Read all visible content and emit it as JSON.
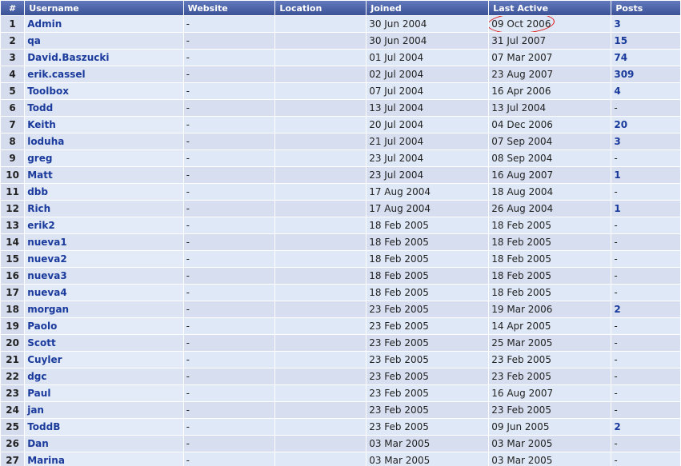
{
  "headers": {
    "num": "#",
    "username": "Username",
    "website": "Website",
    "location": "Location",
    "joined": "Joined",
    "last_active": "Last Active",
    "posts": "Posts"
  },
  "rows": [
    {
      "num": "1",
      "username": "Admin",
      "website": "-",
      "location": "",
      "joined": "30 Jun 2004",
      "last": "09 Oct 2006",
      "posts": "3"
    },
    {
      "num": "2",
      "username": "qa",
      "website": "-",
      "location": "",
      "joined": "30 Jun 2004",
      "last": "31 Jul 2007",
      "posts": "15"
    },
    {
      "num": "3",
      "username": "David.Baszucki",
      "website": "-",
      "location": "",
      "joined": "01 Jul 2004",
      "last": "07 Mar 2007",
      "posts": "74"
    },
    {
      "num": "4",
      "username": "erik.cassel",
      "website": "-",
      "location": "",
      "joined": "02 Jul 2004",
      "last": "23 Aug 2007",
      "posts": "309"
    },
    {
      "num": "5",
      "username": "Toolbox",
      "website": "-",
      "location": "",
      "joined": "07 Jul 2004",
      "last": "16 Apr 2006",
      "posts": "4"
    },
    {
      "num": "6",
      "username": "Todd",
      "website": "-",
      "location": "",
      "joined": "13 Jul 2004",
      "last": "13 Jul 2004",
      "posts": "-"
    },
    {
      "num": "7",
      "username": "Keith",
      "website": "-",
      "location": "",
      "joined": "20 Jul 2004",
      "last": "04 Dec 2006",
      "posts": "20"
    },
    {
      "num": "8",
      "username": "loduha",
      "website": "-",
      "location": "",
      "joined": "21 Jul 2004",
      "last": "07 Sep 2004",
      "posts": "3"
    },
    {
      "num": "9",
      "username": "greg",
      "website": "-",
      "location": "",
      "joined": "23 Jul 2004",
      "last": "08 Sep 2004",
      "posts": "-"
    },
    {
      "num": "10",
      "username": "Matt",
      "website": "-",
      "location": "",
      "joined": "23 Jul 2004",
      "last": "16 Aug 2007",
      "posts": "1"
    },
    {
      "num": "11",
      "username": "dbb",
      "website": "-",
      "location": "",
      "joined": "17 Aug 2004",
      "last": "18 Aug 2004",
      "posts": "-"
    },
    {
      "num": "12",
      "username": "Rich",
      "website": "-",
      "location": "",
      "joined": "17 Aug 2004",
      "last": "26 Aug 2004",
      "posts": "1"
    },
    {
      "num": "13",
      "username": "erik2",
      "website": "-",
      "location": "",
      "joined": "18 Feb 2005",
      "last": "18 Feb 2005",
      "posts": "-"
    },
    {
      "num": "14",
      "username": "nueva1",
      "website": "-",
      "location": "",
      "joined": "18 Feb 2005",
      "last": "18 Feb 2005",
      "posts": "-"
    },
    {
      "num": "15",
      "username": "nueva2",
      "website": "-",
      "location": "",
      "joined": "18 Feb 2005",
      "last": "18 Feb 2005",
      "posts": "-"
    },
    {
      "num": "16",
      "username": "nueva3",
      "website": "-",
      "location": "",
      "joined": "18 Feb 2005",
      "last": "18 Feb 2005",
      "posts": "-"
    },
    {
      "num": "17",
      "username": "nueva4",
      "website": "-",
      "location": "",
      "joined": "18 Feb 2005",
      "last": "18 Feb 2005",
      "posts": "-"
    },
    {
      "num": "18",
      "username": "morgan",
      "website": "-",
      "location": "",
      "joined": "23 Feb 2005",
      "last": "19 Mar 2006",
      "posts": "2"
    },
    {
      "num": "19",
      "username": "Paolo",
      "website": "-",
      "location": "",
      "joined": "23 Feb 2005",
      "last": "14 Apr 2005",
      "posts": "-"
    },
    {
      "num": "20",
      "username": "Scott",
      "website": "-",
      "location": "",
      "joined": "23 Feb 2005",
      "last": "25 Mar 2005",
      "posts": "-"
    },
    {
      "num": "21",
      "username": "Cuyler",
      "website": "-",
      "location": "",
      "joined": "23 Feb 2005",
      "last": "23 Feb 2005",
      "posts": "-"
    },
    {
      "num": "22",
      "username": "dgc",
      "website": "-",
      "location": "",
      "joined": "23 Feb 2005",
      "last": "23 Feb 2005",
      "posts": "-"
    },
    {
      "num": "23",
      "username": "Paul",
      "website": "-",
      "location": "",
      "joined": "23 Feb 2005",
      "last": "16 Aug 2007",
      "posts": "-"
    },
    {
      "num": "24",
      "username": "jan",
      "website": "-",
      "location": "",
      "joined": "23 Feb 2005",
      "last": "23 Feb 2005",
      "posts": "-"
    },
    {
      "num": "25",
      "username": "ToddB",
      "website": "-",
      "location": "",
      "joined": "23 Feb 2005",
      "last": "09 Jun 2005",
      "posts": "2"
    },
    {
      "num": "26",
      "username": "Dan",
      "website": "-",
      "location": "",
      "joined": "03 Mar 2005",
      "last": "03 Mar 2005",
      "posts": "-"
    },
    {
      "num": "27",
      "username": "Marina",
      "website": "-",
      "location": "",
      "joined": "03 Mar 2005",
      "last": "03 Mar 2005",
      "posts": "-"
    }
  ],
  "annotation": {
    "circled_row": 0,
    "color": "#e01010"
  },
  "colors": {
    "header_bg": "#4a62a8",
    "link": "#1a3a9c",
    "row_odd": "#dfe8f6",
    "row_even": "#d6deef"
  }
}
